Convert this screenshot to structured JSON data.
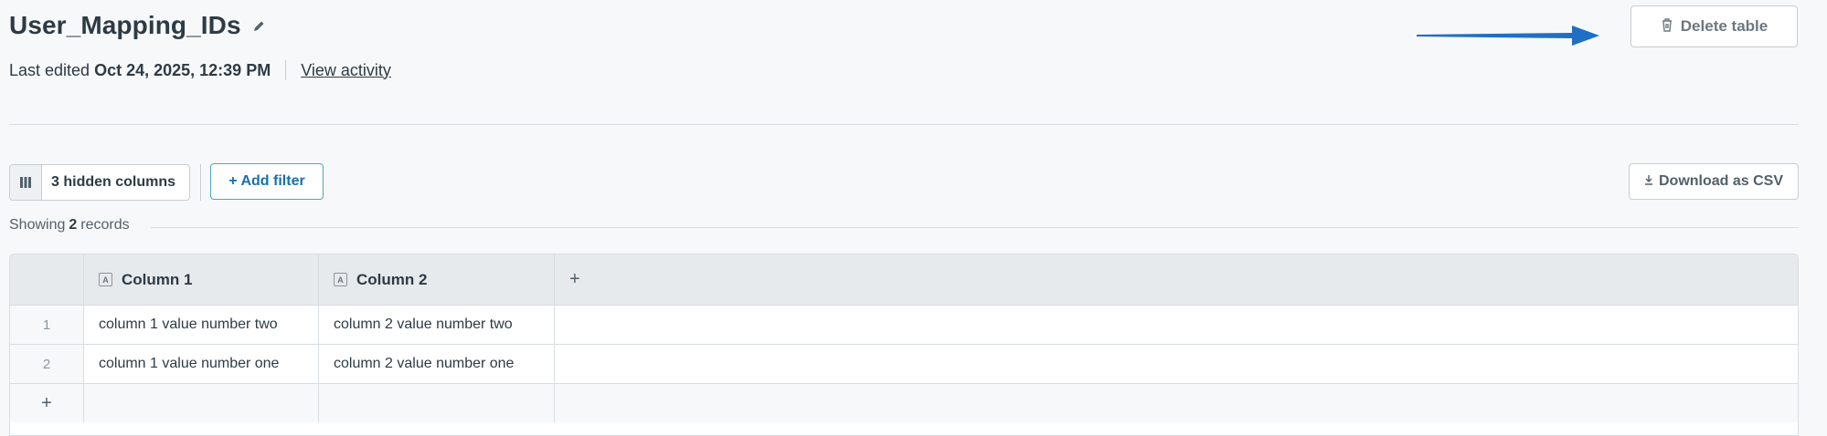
{
  "header": {
    "title": "User_Mapping_IDs",
    "last_edited_label": "Last edited",
    "last_edited_date": "Oct 24, 2025, 12:39 PM",
    "view_activity_label": "View activity",
    "delete_label": "Delete table"
  },
  "toolbar": {
    "hidden_columns_label": "3 hidden columns",
    "add_filter_label": "+ Add filter",
    "download_label": "Download as CSV"
  },
  "records": {
    "prefix": "Showing",
    "count": "2",
    "suffix": "records"
  },
  "table": {
    "columns": [
      {
        "label": "Column 1",
        "type_icon": "A"
      },
      {
        "label": "Column 2",
        "type_icon": "A"
      }
    ],
    "add_column_label": "+",
    "add_row_label": "+",
    "rows": [
      {
        "index": "1",
        "cells": [
          "column 1 value number two",
          "column 2 value number two"
        ]
      },
      {
        "index": "2",
        "cells": [
          "column 1 value number one",
          "column 2 value number one"
        ]
      }
    ]
  },
  "colors": {
    "accent": "#1a6fa8",
    "arrow": "#1f6fc4",
    "border": "#c7cdd1"
  }
}
